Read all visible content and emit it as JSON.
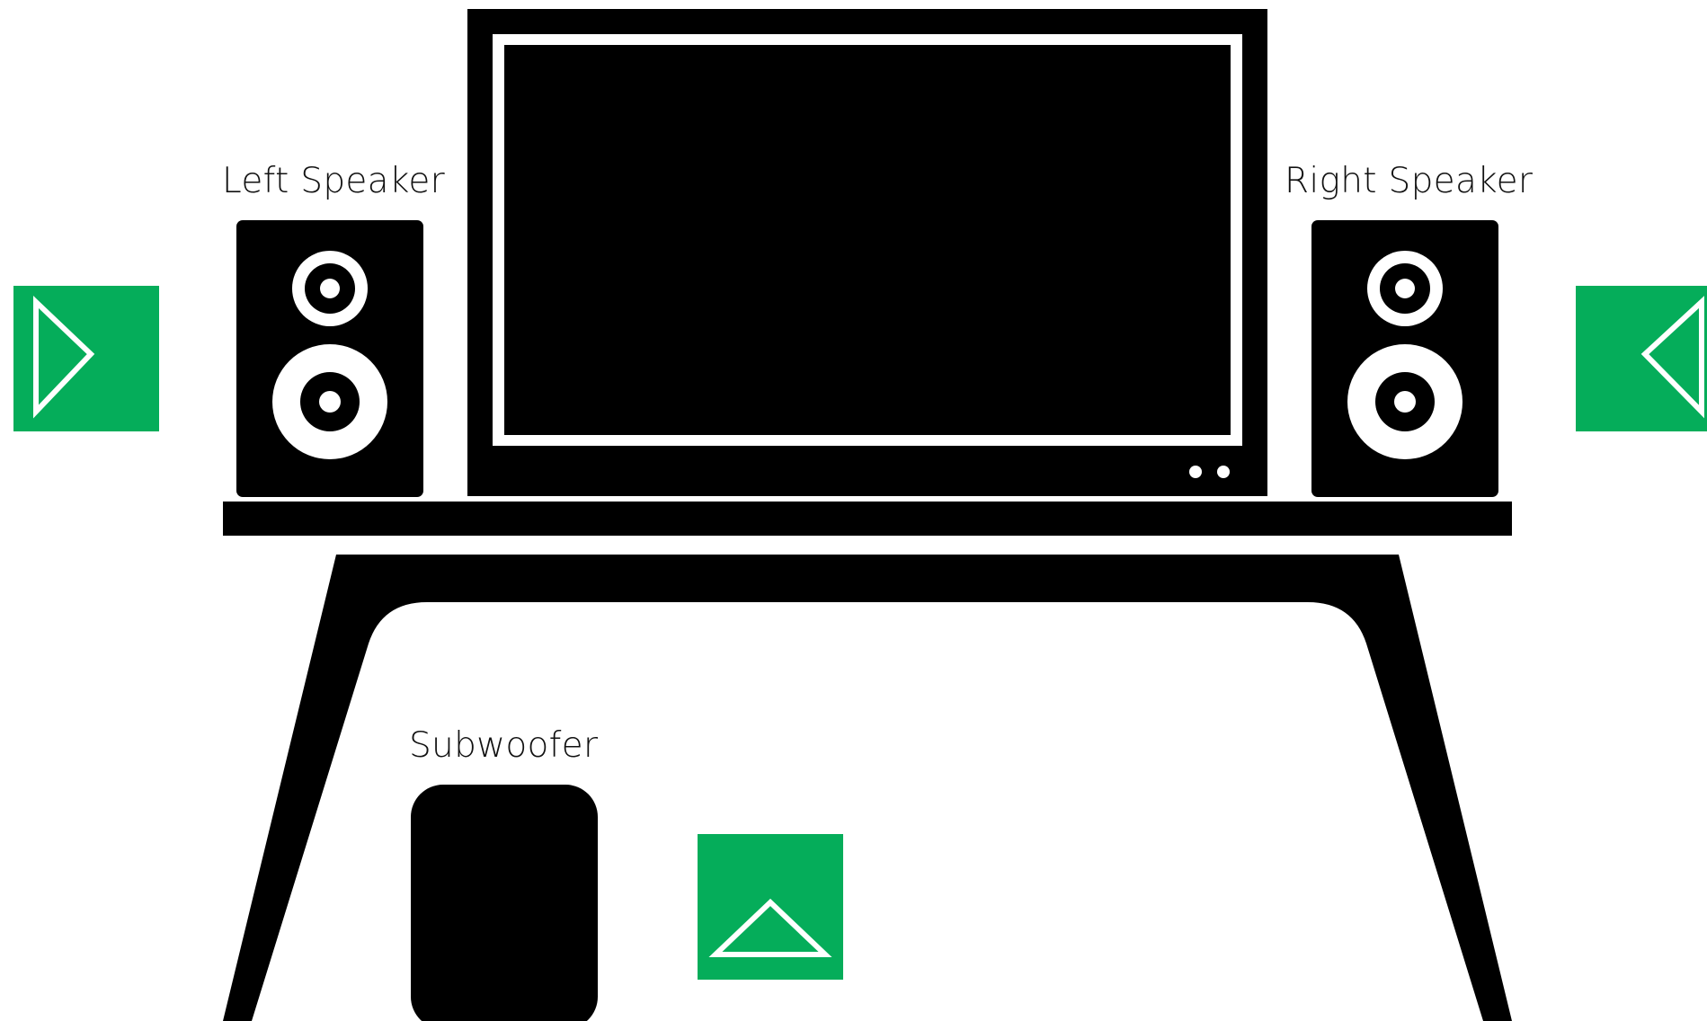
{
  "labels": {
    "left_speaker": "Left Speaker",
    "right_speaker": "Right Speaker",
    "subwoofer": "Subwoofer"
  },
  "buttons": {
    "left_arrow_icon": "play-right-triangle-icon",
    "right_arrow_icon": "play-left-triangle-icon",
    "subwoofer_arrow_icon": "up-triangle-icon"
  },
  "colors": {
    "accent_green": "#05ad5a",
    "furniture_black": "#000000",
    "background": "#ffffff"
  }
}
